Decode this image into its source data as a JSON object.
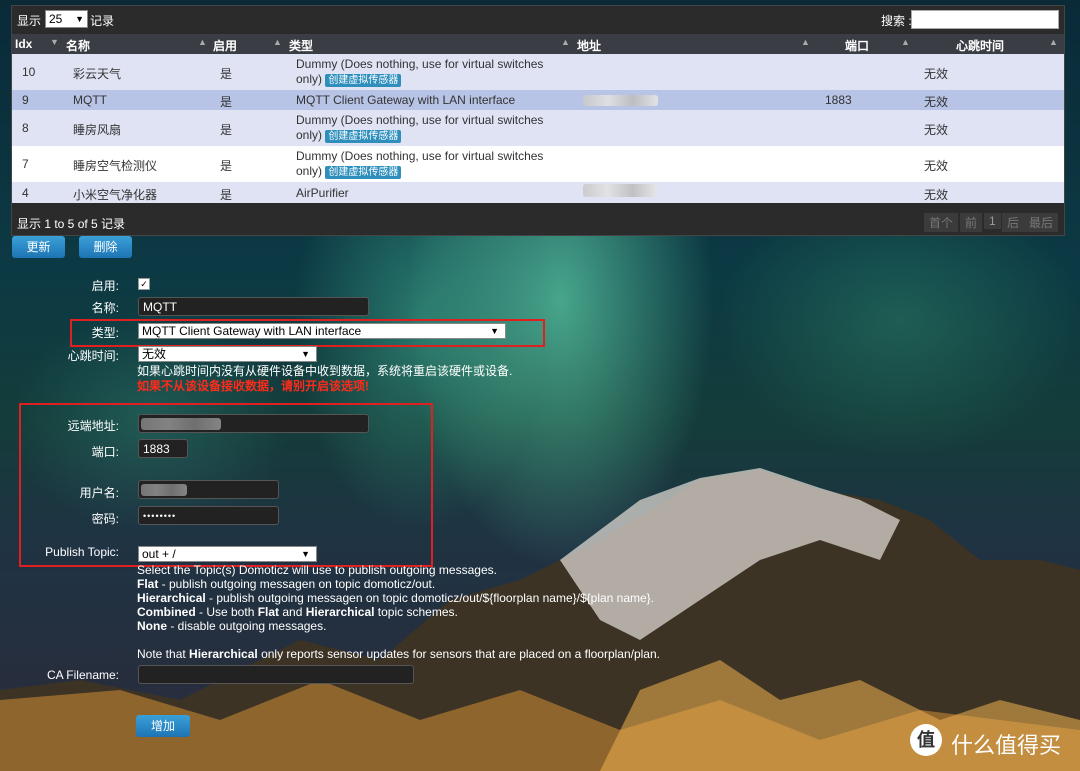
{
  "table": {
    "show_label": "显示",
    "page_size": "25",
    "records_label": "记录",
    "search_label": "搜索 :",
    "columns": [
      "Idx",
      "名称",
      "启用",
      "类型",
      "地址",
      "端口",
      "心跳时间"
    ],
    "rows": [
      {
        "idx": "10",
        "name": "彩云天气",
        "enabled": "是",
        "type": "Dummy (Does nothing, use for virtual switches",
        "type2": "only)",
        "has_create": true,
        "address": "",
        "port": "",
        "heartbeat": "无效"
      },
      {
        "idx": "9",
        "name": "MQTT",
        "enabled": "是",
        "type": "MQTT Client Gateway with LAN interface",
        "type2": "",
        "has_create": false,
        "address": "blurred",
        "port": "1883",
        "heartbeat": "无效"
      },
      {
        "idx": "8",
        "name": "睡房风扇",
        "enabled": "是",
        "type": "Dummy (Does nothing, use for virtual switches",
        "type2": "only)",
        "has_create": true,
        "address": "",
        "port": "",
        "heartbeat": "无效"
      },
      {
        "idx": "7",
        "name": "睡房空气检测仪",
        "enabled": "是",
        "type": "Dummy (Does nothing, use for virtual switches",
        "type2": "only)",
        "has_create": true,
        "address": "",
        "port": "",
        "heartbeat": "无效"
      },
      {
        "idx": "4",
        "name": "小米空气净化器",
        "enabled": "是",
        "type": "AirPurifier",
        "type2": "",
        "has_create": false,
        "address": "blurred",
        "port": "",
        "heartbeat": "无效"
      }
    ],
    "create_sensor_label": "创建虚拟传感器",
    "footer_info": "显示 1 to 5 of 5 记录",
    "pager": {
      "first": "首个",
      "prev": "前",
      "page": "1",
      "next": "后",
      "last": "最后"
    }
  },
  "actions": {
    "update": "更新",
    "delete": "删除",
    "add": "增加"
  },
  "form": {
    "enabled_label": "启用:",
    "name_label": "名称:",
    "name_value": "MQTT",
    "type_label": "类型:",
    "type_value": "MQTT Client Gateway with LAN interface",
    "heartbeat_label": "心跳时间:",
    "heartbeat_value": "无效",
    "heartbeat_help": "如果心跳时间内没有从硬件设备中收到数据，系统将重启该硬件或设备.",
    "heartbeat_warn": "如果不从该设备接收数据，请别开启该选项!",
    "remote_label": "远端地址:",
    "port_label": "端口:",
    "port_value": "1883",
    "username_label": "用户名:",
    "password_label": "密码:",
    "password_value": "••••••••",
    "publish_label": "Publish Topic:",
    "publish_value": "out + /",
    "publish_help_1": "Select the Topic(s) Domoticz will use to publish outgoing messages.",
    "flat_term": "Flat",
    "flat_desc": " - publish outgoing messagen on topic domoticz/out.",
    "hier_term": "Hierarchical",
    "hier_desc": " - publish outgoing messagen on topic domoticz/out/${floorplan name}/${plan name}.",
    "comb_term": "Combined",
    "comb_mid1": " - Use both ",
    "comb_flat": "Flat",
    "comb_mid2": " and ",
    "comb_hier": "Hierarchical",
    "comb_end": " topic schemes.",
    "none_term": "None",
    "none_desc": " - disable outgoing messages.",
    "note_pre": "Note that ",
    "note_term": "Hierarchical",
    "note_post": " only reports sensor updates for sensors that are placed on a floorplan/plan.",
    "ca_label": "CA Filename:"
  },
  "watermark": {
    "symbol": "值",
    "text": "什么值得买"
  },
  "colors": {
    "highlight": "#e02020",
    "button": "#2f8fbc",
    "row_selected": "#b8c4e6",
    "row_alt": "#dfe3f4"
  }
}
